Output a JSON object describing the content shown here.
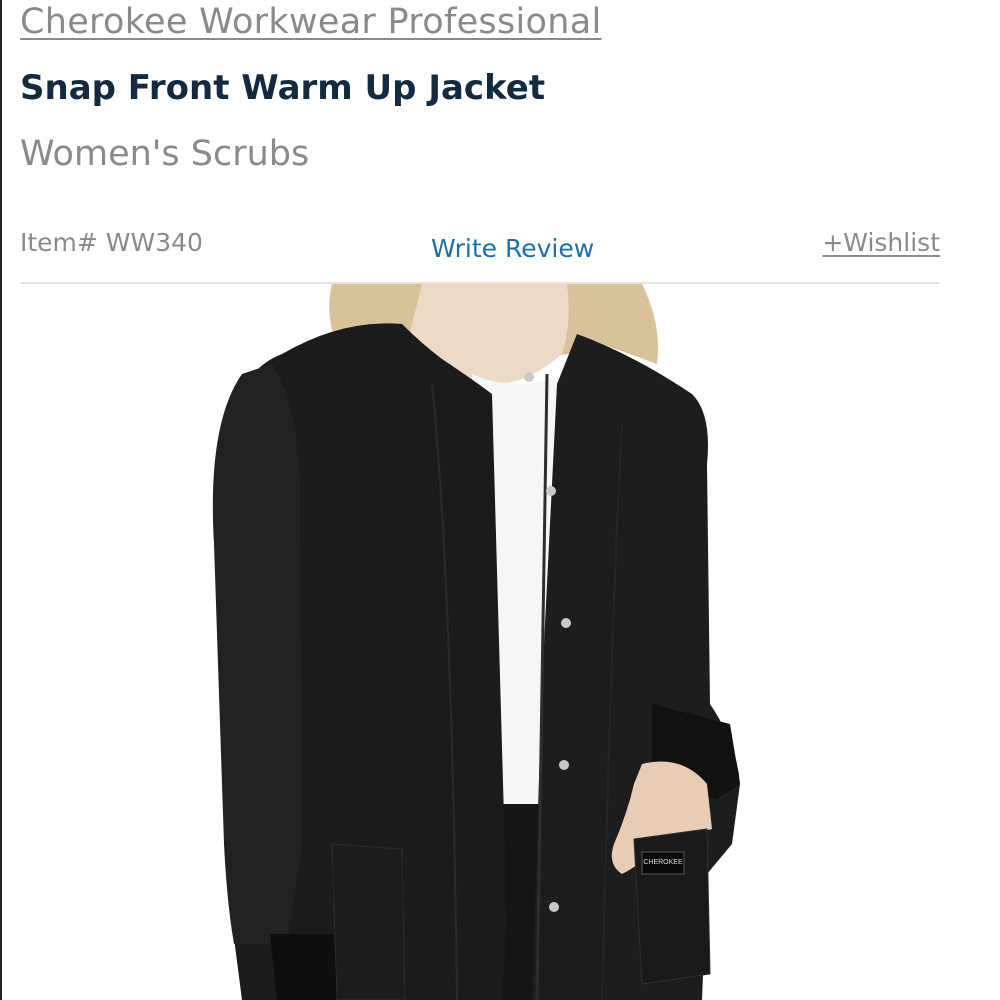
{
  "product": {
    "brand": "Cherokee Workwear Professional",
    "title": "Snap Front Warm Up Jacket",
    "category": "Women's Scrubs",
    "item_number": "Item# WW340",
    "image_alt": "Black snap front warm up jacket worn over white top",
    "image_label": "CHEROKEE"
  },
  "actions": {
    "write_review": "Write Review",
    "wishlist": "+Wishlist"
  },
  "colors": {
    "title": "#142a3e",
    "muted_text": "#8a8a8a",
    "link": "#1d6fa8",
    "divider": "#e3e3e3",
    "jacket": "#1b1b1b"
  }
}
